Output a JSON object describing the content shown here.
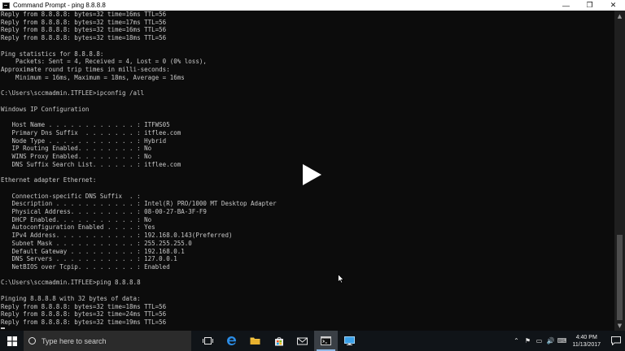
{
  "window": {
    "title": "Command Prompt - ping  8.8.8.8",
    "minimize_glyph": "—",
    "maximize_glyph": "❐",
    "close_glyph": "✕"
  },
  "console": {
    "lines": [
      "Reply from 8.8.8.8: bytes=32 time=16ms TTL=56",
      "Reply from 8.8.8.8: bytes=32 time=17ms TTL=56",
      "Reply from 8.8.8.8: bytes=32 time=16ms TTL=56",
      "Reply from 8.8.8.8: bytes=32 time=18ms TTL=56",
      "",
      "Ping statistics for 8.8.8.8:",
      "    Packets: Sent = 4, Received = 4, Lost = 0 (0% loss),",
      "Approximate round trip times in milli-seconds:",
      "    Minimum = 16ms, Maximum = 18ms, Average = 16ms",
      "",
      "C:\\Users\\sccmadmin.ITFLEE>ipconfig /all",
      "",
      "Windows IP Configuration",
      "",
      "   Host Name . . . . . . . . . . . . : ITFWS05",
      "   Primary Dns Suffix  . . . . . . . : itflee.com",
      "   Node Type . . . . . . . . . . . . : Hybrid",
      "   IP Routing Enabled. . . . . . . . : No",
      "   WINS Proxy Enabled. . . . . . . . : No",
      "   DNS Suffix Search List. . . . . . : itflee.com",
      "",
      "Ethernet adapter Ethernet:",
      "",
      "   Connection-specific DNS Suffix  . :",
      "   Description . . . . . . . . . . . : Intel(R) PRO/1000 MT Desktop Adapter",
      "   Physical Address. . . . . . . . . : 08-00-27-BA-3F-F9",
      "   DHCP Enabled. . . . . . . . . . . : No",
      "   Autoconfiguration Enabled . . . . : Yes",
      "   IPv4 Address. . . . . . . . . . . : 192.168.0.143(Preferred)",
      "   Subnet Mask . . . . . . . . . . . : 255.255.255.0",
      "   Default Gateway . . . . . . . . . : 192.168.0.1",
      "   DNS Servers . . . . . . . . . . . : 127.0.0.1",
      "   NetBIOS over Tcpip. . . . . . . . : Enabled",
      "",
      "C:\\Users\\sccmadmin.ITFLEE>ping 8.8.8.8",
      "",
      "Pinging 8.8.8.8 with 32 bytes of data:",
      "Reply from 8.8.8.8: bytes=32 time=18ms TTL=56",
      "Reply from 8.8.8.8: bytes=32 time=24ms TTL=56",
      "Reply from 8.8.8.8: bytes=32 time=19ms TTL=56"
    ]
  },
  "taskbar": {
    "search_placeholder": "Type here to search",
    "clock_time": "4:40 PM",
    "clock_date": "11/13/2017",
    "apps": [
      "task-view",
      "edge",
      "file-explorer",
      "store",
      "mail",
      "command-prompt",
      "remote-desktop"
    ]
  },
  "colors": {
    "console_bg": "#0c0c0c",
    "console_text": "#c8c8c8",
    "taskbar_bg": "#101418",
    "accent": "#0078d7"
  }
}
